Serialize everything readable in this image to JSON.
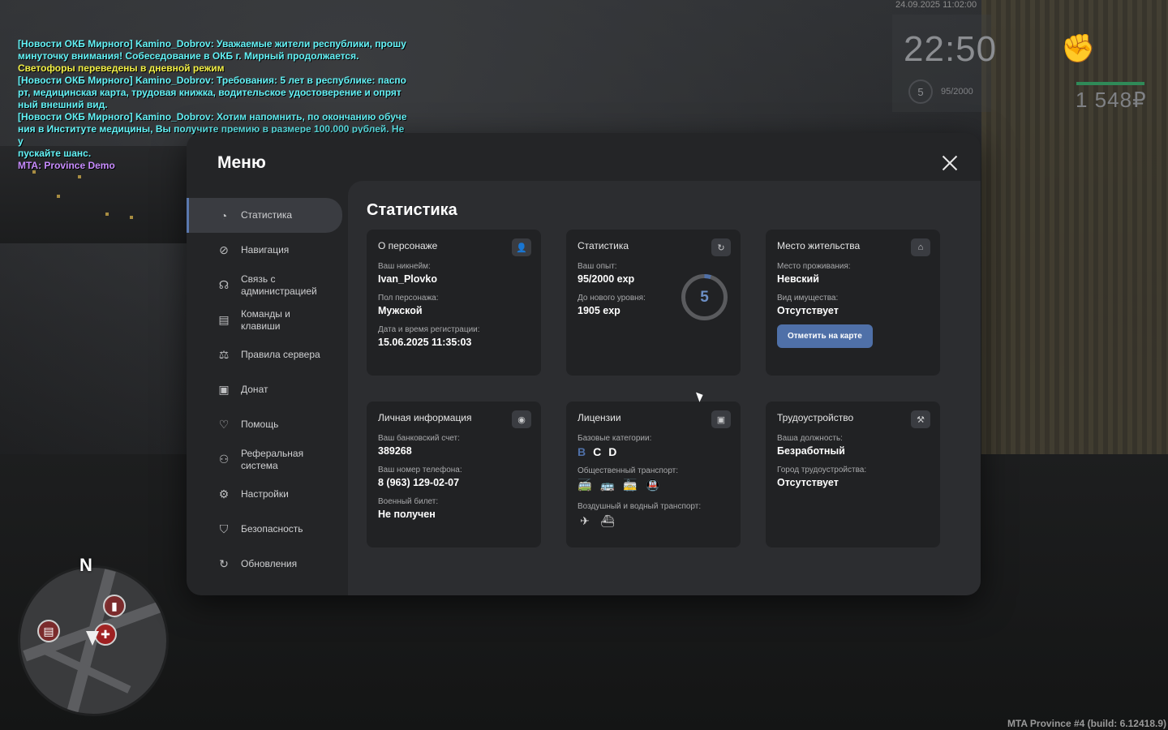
{
  "chat": [
    {
      "cls": "news",
      "text": "[Новости ОКБ Мирного] Kamino_Dobrov: Уважаемые жители республики, прошу"
    },
    {
      "cls": "news",
      "text": "минуточку внимания! Собеседование в ОКБ г. Мирный продолжается."
    },
    {
      "cls": "yellow",
      "text": "Светофоры переведены в дневной режим"
    },
    {
      "cls": "news",
      "text": "[Новости ОКБ Мирного] Kamino_Dobrov: Требования: 5 лет в республике: паспо"
    },
    {
      "cls": "news",
      "text": "рт, медицинская карта, трудовая книжка, водительское удостоверение и опрят"
    },
    {
      "cls": "news",
      "text": "ный внешний вид."
    },
    {
      "cls": "news",
      "text": "[Новости ОКБ Мирного] Kamino_Dobrov: Хотим напомнить, по окончанию обуче"
    },
    {
      "cls": "news",
      "text": "ния в Институте медицины, Вы получите премию в размере 100.000 рублей. Не у"
    },
    {
      "cls": "news",
      "text": "пускайте шанс."
    },
    {
      "cls": "purple",
      "text": "MTA: Province Demo"
    }
  ],
  "hud": {
    "datetime": "24.09.2025 11:02:00",
    "time": "22:50",
    "level": "5",
    "exp": "95/2000",
    "money": "1 548₽",
    "health_fraction": 1.0
  },
  "minimap": {
    "north": "N"
  },
  "build": "MTA Province #4 (build: 6.12418.9)",
  "menu": {
    "title": "Меню",
    "sidebar": [
      {
        "label": "Статистика",
        "icon": "pie-chart-icon",
        "glyph": "◔",
        "active": true
      },
      {
        "label": "Навигация",
        "icon": "compass-icon",
        "glyph": "⊘",
        "active": false
      },
      {
        "label": "Связь с администрацией",
        "icon": "headset-icon",
        "glyph": "☊",
        "active": false
      },
      {
        "label": "Команды и клавиши",
        "icon": "document-icon",
        "glyph": "▤",
        "active": false
      },
      {
        "label": "Правила сервера",
        "icon": "scales-icon",
        "glyph": "⚖",
        "active": false
      },
      {
        "label": "Донат",
        "icon": "wallet-icon",
        "glyph": "▣",
        "active": false
      },
      {
        "label": "Помощь",
        "icon": "heart-hand-icon",
        "glyph": "♡",
        "active": false
      },
      {
        "label": "Реферальная система",
        "icon": "people-icon",
        "glyph": "⚇",
        "active": false
      },
      {
        "label": "Настройки",
        "icon": "gear-icon",
        "glyph": "⚙",
        "active": false
      },
      {
        "label": "Безопасность",
        "icon": "shield-icon",
        "glyph": "⛉",
        "active": false
      },
      {
        "label": "Обновления",
        "icon": "refresh-icon",
        "glyph": "↻",
        "active": false
      }
    ],
    "content_title": "Статистика",
    "character": {
      "title": "О персонаже",
      "nick_label": "Ваш никнейм:",
      "nick": "Ivan_Plovko",
      "gender_label": "Пол персонажа:",
      "gender": "Мужской",
      "reg_label": "Дата и время регистрации:",
      "reg": "15.06.2025 11:35:03"
    },
    "stats": {
      "title": "Статистика",
      "exp_label": "Ваш опыт:",
      "exp": "95/2000 exp",
      "next_label": "До нового уровня:",
      "next": "1905 exp",
      "level": "5",
      "progress_fraction": 0.0475
    },
    "residence": {
      "title": "Место жительства",
      "place_label": "Место проживания:",
      "place": "Невский",
      "property_label": "Вид имущества:",
      "property": "Отсутствует",
      "button": "Отметить на карте"
    },
    "personal": {
      "title": "Личная информация",
      "bank_label": "Ваш банковский счет:",
      "bank": "389268",
      "phone_label": "Ваш номер телефона:",
      "phone": "8 (963) 129-02-07",
      "military_label": "Военный билет:",
      "military": "Не получен"
    },
    "licenses": {
      "title": "Лицензии",
      "base_label": "Базовые категории:",
      "categories": [
        {
          "letter": "B",
          "owned": false
        },
        {
          "letter": "C",
          "owned": true
        },
        {
          "letter": "D",
          "owned": true
        }
      ],
      "public_label": "Общественный транспорт:",
      "air_label": "Воздушный и водный транспорт:"
    },
    "job": {
      "title": "Трудоустройство",
      "position_label": "Ваша должность:",
      "position": "Безработный",
      "city_label": "Город трудоустройства:",
      "city": "Отсутствует"
    }
  }
}
